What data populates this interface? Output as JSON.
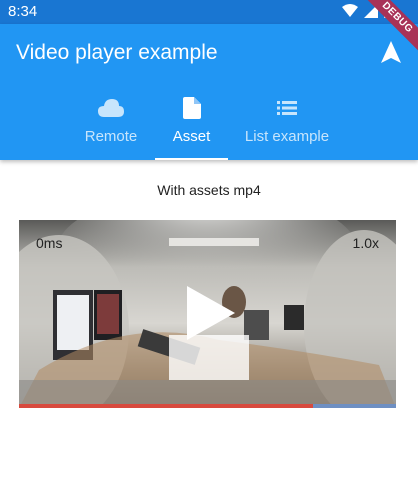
{
  "status": {
    "time": "8:34"
  },
  "app": {
    "title": "Video player example",
    "debug_banner": "DEBUG",
    "nav_icon": "navigation-arrow-icon"
  },
  "tabs": [
    {
      "label": "Remote",
      "icon": "cloud-icon",
      "active": false
    },
    {
      "label": "Asset",
      "icon": "file-icon",
      "active": true
    },
    {
      "label": "List example",
      "icon": "list-icon",
      "active": false
    }
  ],
  "content": {
    "caption": "With assets mp4",
    "video": {
      "position_text": "0ms",
      "speed_text": "1.0x",
      "progress_fraction": 0.78,
      "play_icon": "play-icon"
    }
  },
  "colors": {
    "app_bar": "#2196f3",
    "status_bar": "#1976d2",
    "progress_played": "#d84a3e",
    "progress_buffered": "#6e8fc2"
  }
}
